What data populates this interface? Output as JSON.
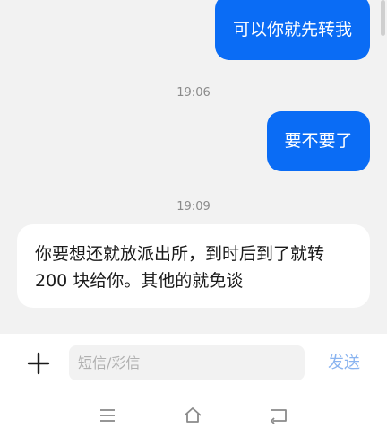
{
  "messages": [
    {
      "direction": "out",
      "text": "可以你就先转我"
    },
    {
      "direction": "out",
      "text": "要不要了"
    },
    {
      "direction": "in",
      "text_line1": "你要想还就放派出所，到时后到了就转",
      "text_line2": "200 块给你。其他的就免谈"
    }
  ],
  "timestamps": [
    "19:06",
    "19:09"
  ],
  "composer": {
    "placeholder": "短信/彩信",
    "send_label": "发送"
  },
  "icons": {
    "attach": "plus-icon",
    "nav_menu": "menu-icon",
    "nav_home": "home-icon",
    "nav_back": "back-icon"
  },
  "colors": {
    "outgoing_bubble": "#0a6cf5",
    "incoming_bubble": "#ffffff",
    "send_disabled": "#8ab4f0"
  }
}
